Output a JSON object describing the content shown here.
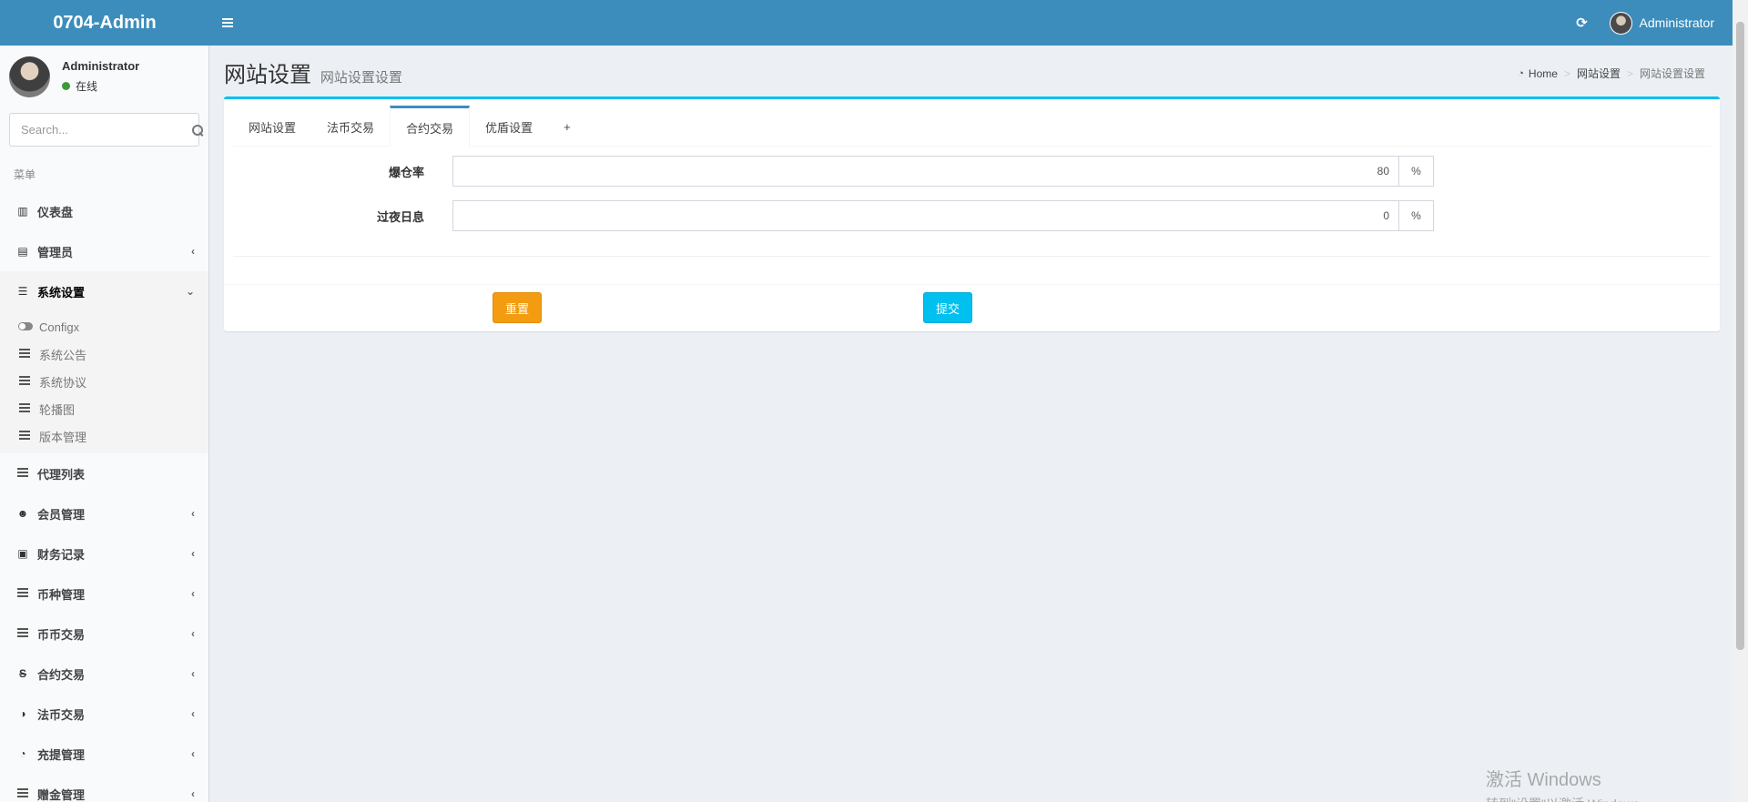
{
  "header": {
    "logo": "0704-Admin",
    "user": "Administrator"
  },
  "sidebar": {
    "user_name": "Administrator",
    "user_status": "在线",
    "search_placeholder": "Search...",
    "menu_header": "菜单",
    "items": [
      {
        "label": "仪表盘",
        "icon": "bar-chart-icon"
      },
      {
        "label": "管理员",
        "icon": "id-card-icon"
      },
      {
        "label": "系统设置",
        "icon": "sliders-icon"
      },
      {
        "label": "代理列表",
        "icon": "list-icon"
      },
      {
        "label": "会员管理",
        "icon": "users-icon"
      },
      {
        "label": "财务记录",
        "icon": "money-icon"
      },
      {
        "label": "币种管理",
        "icon": "list-icon"
      },
      {
        "label": "币币交易",
        "icon": "list-icon"
      },
      {
        "label": "合约交易",
        "icon": "strikethrough-icon"
      },
      {
        "label": "法币交易",
        "icon": "adjust-icon"
      },
      {
        "label": "充提管理",
        "icon": "dashboard-icon"
      },
      {
        "label": "赠金管理",
        "icon": "list-icon"
      }
    ],
    "submenu": [
      {
        "label": "Configx",
        "icon": "toggle-icon"
      },
      {
        "label": "系统公告",
        "icon": "list-icon"
      },
      {
        "label": "系统协议",
        "icon": "list-icon"
      },
      {
        "label": "轮播图",
        "icon": "list-icon"
      },
      {
        "label": "版本管理",
        "icon": "list-icon"
      }
    ]
  },
  "content": {
    "title": "网站设置",
    "subtitle": "网站设置设置",
    "breadcrumb": [
      "Home",
      "网站设置",
      "网站设置设置"
    ],
    "tabs": [
      "网站设置",
      "法币交易",
      "合约交易",
      "优盾设置",
      "+"
    ],
    "active_tab": "合约交易",
    "fields": [
      {
        "label": "爆仓率",
        "value": "80",
        "unit": "%"
      },
      {
        "label": "过夜日息",
        "value": "0",
        "unit": "%"
      }
    ],
    "reset_label": "重置",
    "submit_label": "提交"
  },
  "watermark": {
    "line1": "激活 Windows",
    "line2": "转到\"设置\"以激活 Windows"
  },
  "colors": {
    "header": "#3c8dbc",
    "box_top": "#00c0ef",
    "reset": "#f39c12",
    "submit": "#00c0ef"
  }
}
